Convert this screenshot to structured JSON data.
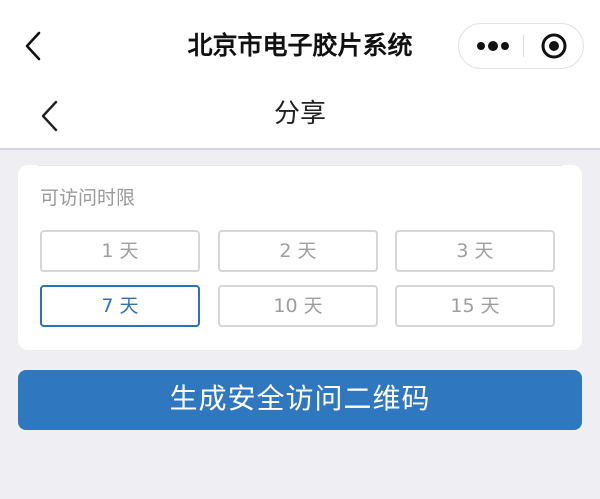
{
  "top_bar": {
    "title": "北京市电子胶片系统",
    "back_icon": "chevron-left-icon",
    "more_icon": "more-dots-icon",
    "close_icon": "record-target-icon"
  },
  "sub_bar": {
    "title": "分享",
    "back_icon": "chevron-left-icon"
  },
  "access_limit": {
    "label": "可访问时限",
    "options": [
      {
        "label": "1 天",
        "selected": false
      },
      {
        "label": "2 天",
        "selected": false
      },
      {
        "label": "3 天",
        "selected": false
      },
      {
        "label": "7 天",
        "selected": true
      },
      {
        "label": "10 天",
        "selected": false
      },
      {
        "label": "15 天",
        "selected": false
      }
    ]
  },
  "generate_button": {
    "label": "生成安全访问二维码"
  },
  "colors": {
    "accent": "#2f77bf",
    "selected_border": "#2e6fbf",
    "background": "#eeeef3"
  }
}
